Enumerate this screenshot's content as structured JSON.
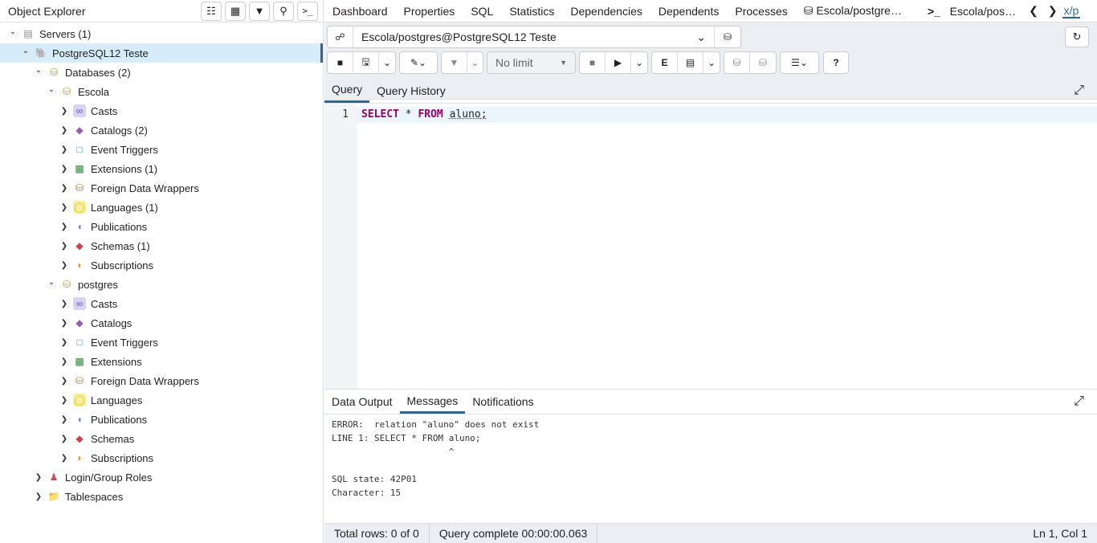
{
  "object_explorer": {
    "title": "Object Explorer",
    "toolbar": [
      "query-tool-icon",
      "table-icon",
      "filter-table-icon",
      "search-icon",
      "terminal-icon"
    ],
    "tree": [
      {
        "label": "Servers (1)",
        "level": 0,
        "icon": "servers-icon",
        "open": true
      },
      {
        "label": "PostgreSQL12 Teste",
        "level": 1,
        "icon": "postgres-elephant-icon",
        "open": true,
        "selected": true
      },
      {
        "label": "Databases (2)",
        "level": 2,
        "icon": "databases-icon",
        "open": true
      },
      {
        "label": "Escola",
        "level": 3,
        "icon": "database-icon",
        "open": true
      },
      {
        "label": "Casts",
        "level": 4,
        "icon": "casts-icon"
      },
      {
        "label": "Catalogs (2)",
        "level": 4,
        "icon": "catalogs-icon"
      },
      {
        "label": "Event Triggers",
        "level": 4,
        "icon": "event-triggers-icon"
      },
      {
        "label": "Extensions (1)",
        "level": 4,
        "icon": "extensions-icon"
      },
      {
        "label": "Foreign Data Wrappers",
        "level": 4,
        "icon": "fdw-icon"
      },
      {
        "label": "Languages (1)",
        "level": 4,
        "icon": "languages-icon"
      },
      {
        "label": "Publications",
        "level": 4,
        "icon": "publications-icon"
      },
      {
        "label": "Schemas (1)",
        "level": 4,
        "icon": "schemas-icon"
      },
      {
        "label": "Subscriptions",
        "level": 4,
        "icon": "subscriptions-icon"
      },
      {
        "label": "postgres",
        "level": 3,
        "icon": "database-icon",
        "open": true
      },
      {
        "label": "Casts",
        "level": 4,
        "icon": "casts-icon"
      },
      {
        "label": "Catalogs",
        "level": 4,
        "icon": "catalogs-icon"
      },
      {
        "label": "Event Triggers",
        "level": 4,
        "icon": "event-triggers-icon"
      },
      {
        "label": "Extensions",
        "level": 4,
        "icon": "extensions-icon"
      },
      {
        "label": "Foreign Data Wrappers",
        "level": 4,
        "icon": "fdw-icon"
      },
      {
        "label": "Languages",
        "level": 4,
        "icon": "languages-icon"
      },
      {
        "label": "Publications",
        "level": 4,
        "icon": "publications-icon"
      },
      {
        "label": "Schemas",
        "level": 4,
        "icon": "schemas-icon"
      },
      {
        "label": "Subscriptions",
        "level": 4,
        "icon": "subscriptions-icon"
      },
      {
        "label": "Login/Group Roles",
        "level": 2,
        "icon": "roles-icon"
      },
      {
        "label": "Tablespaces",
        "level": 2,
        "icon": "tablespaces-icon"
      }
    ]
  },
  "tabs": [
    "Dashboard",
    "Properties",
    "SQL",
    "Statistics",
    "Dependencies",
    "Dependents",
    "Processes",
    "Escola/postgre…",
    "Escola/pos…",
    "x/p"
  ],
  "connection": {
    "value": "Escola/postgres@PostgreSQL12 Teste"
  },
  "toolbar": {
    "limit": "No limit"
  },
  "query_tabs": [
    "Query",
    "Query History"
  ],
  "editor": {
    "line": "1",
    "kw1": "SELECT",
    "star": " * ",
    "kw2": "FROM",
    "ident": "aluno",
    "semi": ";"
  },
  "output_tabs": [
    "Data Output",
    "Messages",
    "Notifications"
  ],
  "messages": "ERROR:  relation \"aluno\" does not exist\nLINE 1: SELECT * FROM aluno;\n                      ^\n\nSQL state: 42P01\nCharacter: 15",
  "status": {
    "rows": "Total rows: 0 of 0",
    "query": "Query complete 00:00:00.063",
    "pos": "Ln 1, Col 1"
  }
}
